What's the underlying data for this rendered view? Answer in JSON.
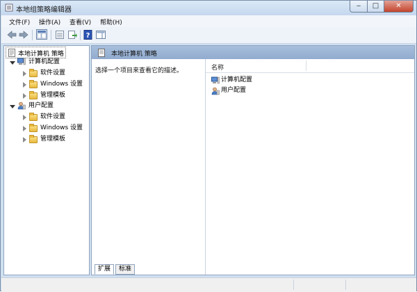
{
  "window": {
    "title": "本地组策略编辑器",
    "controls": {
      "minimize": "‒",
      "maximize": "□",
      "close": "✕"
    }
  },
  "menu": {
    "items": [
      {
        "label": "文件(F)"
      },
      {
        "label": "操作(A)"
      },
      {
        "label": "查看(V)"
      },
      {
        "label": "帮助(H)"
      }
    ]
  },
  "toolbar": {
    "icons": [
      "back-arrow-icon",
      "forward-arrow-icon",
      "show-hide-tree-icon",
      "properties-icon",
      "export-list-icon",
      "help-icon",
      "show-hide-action-pane-icon"
    ]
  },
  "tree": {
    "root": {
      "label": "本地计算机 策略"
    },
    "computer": {
      "label": "计算机配置",
      "children": [
        {
          "label": "软件设置"
        },
        {
          "label": "Windows 设置"
        },
        {
          "label": "管理模板"
        }
      ]
    },
    "user": {
      "label": "用户配置",
      "children": [
        {
          "label": "软件设置"
        },
        {
          "label": "Windows 设置"
        },
        {
          "label": "管理模板"
        }
      ]
    }
  },
  "right": {
    "header_title": "本地计算机 策略",
    "description": "选择一个项目来查看它的描述。",
    "list_column": "名称",
    "items": [
      {
        "label": "计算机配置"
      },
      {
        "label": "用户配置"
      }
    ],
    "tabs": [
      {
        "label": "扩展"
      },
      {
        "label": "标准"
      }
    ]
  },
  "colors": {
    "title_bar": "#c4d7ee",
    "header_bar": "#91abcf",
    "close_button": "#c2432c"
  }
}
